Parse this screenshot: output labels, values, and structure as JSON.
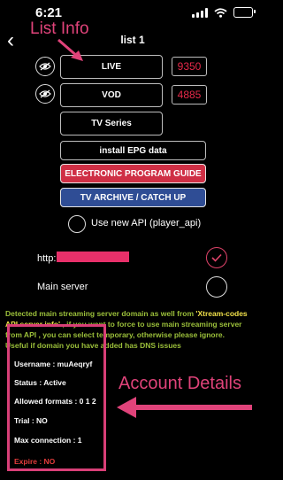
{
  "status_bar": {
    "time": "6:21"
  },
  "header": {
    "title": "list 1"
  },
  "annotations": {
    "list_info": "List Info",
    "account_details": "Account Details"
  },
  "buttons": {
    "live": {
      "label": "LIVE",
      "count": "9350"
    },
    "vod": {
      "label": "VOD",
      "count": "4885"
    },
    "tv_series": "TV Series",
    "install_epg": "install EPG data",
    "epg": "ELECTRONIC PROGRAM GUIDE",
    "archive": "TV ARCHIVE / CATCH UP"
  },
  "options": {
    "new_api": "Use new API (player_api)",
    "server_url": "http:",
    "main_server": "Main server"
  },
  "info": {
    "part1": "Detected main streaming server domain as well from ",
    "highlight": "'Xtream-codes API server info'",
    "part2": " , if you want to force to use main streaming server from API , you can select temporary, otherwise please ignore.",
    "part3": "Useful if domain you have added has DNS issues"
  },
  "account": {
    "username": "Username  : muAeqryf",
    "status": "Status  : Active",
    "formats": "Allowed formats  :  0  1  2",
    "trial": "Trial  : NO",
    "max_connection": "Max connection  : 1",
    "expire": "Expire : NO"
  },
  "colors": {
    "accent": "#e0437a",
    "epg_red": "#cf2f45",
    "archive_blue": "#2f4d95",
    "info_green": "#9bbf3a",
    "info_yellow": "#f0e04a"
  }
}
